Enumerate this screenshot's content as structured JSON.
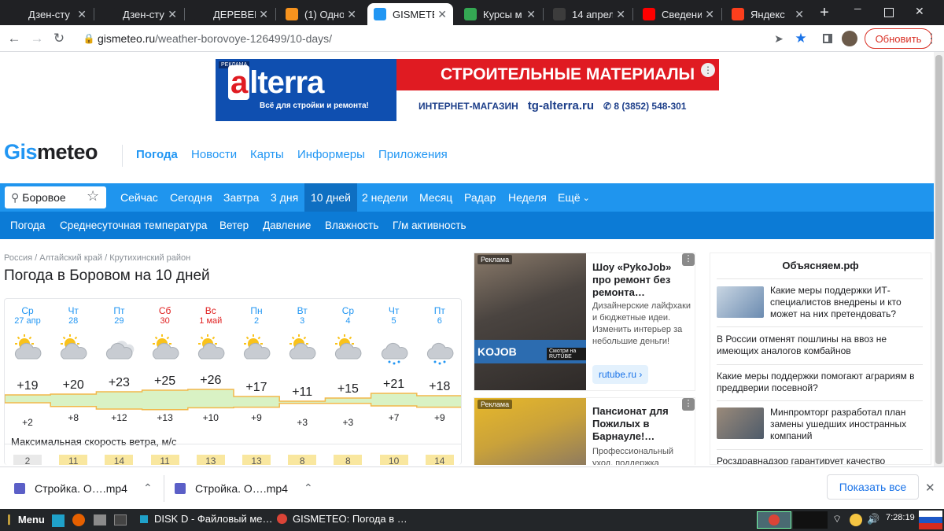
{
  "browser": {
    "tabs": [
      {
        "title": "Дзен-сту",
        "fav_color": "#202124",
        "fav_icon": "dzen-icon"
      },
      {
        "title": "Дзен-сту",
        "fav_color": "#202124",
        "fav_icon": "dzen-icon"
      },
      {
        "title": "ДЕРЕВЕН",
        "fav_color": "#202124",
        "fav_icon": "dzen-icon"
      },
      {
        "title": "(1) Одно",
        "fav_color": "#f7931e",
        "fav_icon": "ok-icon"
      },
      {
        "title": "GISMETE",
        "fav_color": "#2196f3",
        "fav_icon": "gismeteo-icon"
      },
      {
        "title": "Курсы м",
        "fav_color": "#34a853",
        "fav_icon": "courses-icon"
      },
      {
        "title": "14 апрел",
        "fav_color": "#3c3c3c",
        "fav_icon": "doc-icon"
      },
      {
        "title": "Сведени",
        "fav_color": "#ff0000",
        "fav_icon": "youtube-icon"
      },
      {
        "title": "Яндекс",
        "fav_color": "#fc3f1d",
        "fav_icon": "yandex-icon"
      }
    ],
    "url_host": "gismeteo.ru",
    "url_path": "/weather-borovoye-126499/10-days/",
    "update_label": "Обновить"
  },
  "banner": {
    "ad_label": "РЕКЛАМА",
    "logo_a": "a",
    "logo_rest": "lterra",
    "tagline": "Всё для стройки и ремонта!",
    "headline": "СТРОИТЕЛЬНЫЕ МАТЕРИАЛЫ",
    "shop": "ИНТЕРНЕТ-МАГАЗИН",
    "site": "tg-alterra.ru",
    "phone": "8 (3852) 548-301"
  },
  "site": {
    "logo_gis": "Gis",
    "logo_meteo": "meteo",
    "main_nav": [
      "Погода",
      "Новости",
      "Карты",
      "Информеры",
      "Приложения"
    ],
    "search_value": "Боровое",
    "period_tabs": [
      "Сейчас",
      "Сегодня",
      "Завтра",
      "3 дня",
      "10 дней",
      "2 недели",
      "Месяц",
      "Радар",
      "Неделя",
      "Ещё"
    ],
    "sub_tabs": [
      "Погода",
      "Среднесуточная температура",
      "Ветер",
      "Давление",
      "Влажность",
      "Г/м активность"
    ]
  },
  "forecast": {
    "breadcrumb": "Россия / Алтайский край / Крутихинский район",
    "title": "Погода в Боровом на 10 дней",
    "wind_label": "Максимальная скорость ветра, м/с",
    "days": [
      {
        "name": "Ср",
        "date": "27 апр",
        "weekend": false,
        "icon": "partly-cloudy-icon",
        "max": "+19",
        "min": "+2",
        "wind": "2"
      },
      {
        "name": "Чт",
        "date": "28",
        "weekend": false,
        "icon": "partly-cloudy-icon",
        "max": "+20",
        "min": "+8",
        "wind": "11"
      },
      {
        "name": "Пт",
        "date": "29",
        "weekend": false,
        "icon": "cloudy-icon",
        "max": "+23",
        "min": "+12",
        "wind": "14"
      },
      {
        "name": "Сб",
        "date": "30",
        "weekend": true,
        "icon": "partly-cloudy-icon",
        "max": "+25",
        "min": "+13",
        "wind": "11"
      },
      {
        "name": "Вс",
        "date": "1 май",
        "weekend": true,
        "icon": "partly-cloudy-icon",
        "max": "+26",
        "min": "+10",
        "wind": "13"
      },
      {
        "name": "Пн",
        "date": "2",
        "weekend": false,
        "icon": "partly-cloudy-icon",
        "max": "+17",
        "min": "+9",
        "wind": "13"
      },
      {
        "name": "Вт",
        "date": "3",
        "weekend": false,
        "icon": "partly-cloudy-icon",
        "max": "+11",
        "min": "+3",
        "wind": "8"
      },
      {
        "name": "Ср",
        "date": "4",
        "weekend": false,
        "icon": "partly-cloudy-icon",
        "max": "+15",
        "min": "+3",
        "wind": "8"
      },
      {
        "name": "Чт",
        "date": "5",
        "weekend": false,
        "icon": "rain-icon",
        "max": "+21",
        "min": "+7",
        "wind": "10"
      },
      {
        "name": "Пт",
        "date": "6",
        "weekend": false,
        "icon": "rain-icon",
        "max": "+18",
        "min": "+9",
        "wind": "14"
      }
    ]
  },
  "ads": [
    {
      "label": "Реклама",
      "title": "Шоу «PykoJob» про ремонт без ремонта…",
      "desc": "Дизайнерские лайфхаки и бюджетные идеи. Изменить интерьер за небольшие деньги!",
      "link": "rutube.ru",
      "img_text": "KOJOB",
      "img_badge": "Смотри на RUTUBE"
    },
    {
      "label": "Реклама",
      "title": "Пансионат для Пожилых в Барнауле!…",
      "desc": "Профессиональный уход, поддержка"
    }
  ],
  "right_column": {
    "title": "Объясняем.рф",
    "news": [
      "Какие меры поддержки ИТ-специалистов внедрены и кто может на них претендовать?",
      "В России отменят пошлины на ввоз не имеющих аналогов комбайнов",
      "Какие меры поддержки помогают аграриям в преддверии посевной?",
      "Минпромторг разработал план замены ушедших иностранных компаний",
      "Росздравнадзор гарантирует качество"
    ]
  },
  "downloads": {
    "items": [
      "Стройка. О….mp4",
      "Стройка. О….mp4"
    ],
    "show_all": "Показать все"
  },
  "taskbar": {
    "menu": "Menu",
    "windows": [
      "DISK D - Файловый ме…",
      "GISMETEO: Погода в …"
    ],
    "clock": "7:28:19"
  }
}
